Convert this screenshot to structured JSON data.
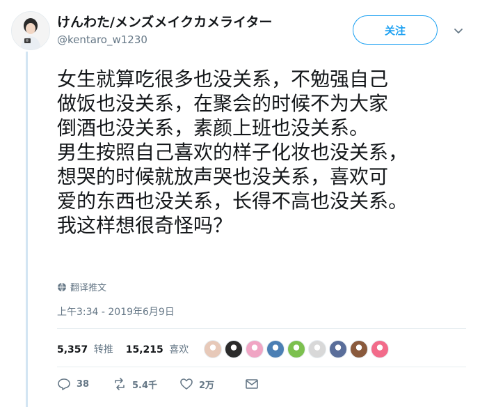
{
  "author": {
    "display_name": "けんわた/メンズメイクカメライター",
    "handle": "@kentaro_w1230"
  },
  "follow_button": {
    "label": "关注"
  },
  "tweet": {
    "lines": [
      "女生就算吃很多也没关系，不勉强自己",
      "做饭也没关系，在聚会的时候不为大家",
      "倒酒也没关系，素颜上班也没关系。",
      "男生按照自己喜欢的样子化妆也没关系，",
      "想哭的时候就放声哭也没关系，喜欢可",
      "爱的东西也没关系，长得不高也没关系。",
      "我这样想很奇怪吗？"
    ],
    "translate_label": "翻译推文",
    "timestamp": "上午3:34 - 2019年6月9日"
  },
  "stats": {
    "retweets_count": "5,357",
    "retweets_label": "转推",
    "likes_count": "15,215",
    "likes_label": "喜欢"
  },
  "liker_avatar_colors": [
    "#e7c9b9",
    "#2b2b2b",
    "#f0a5c4",
    "#4b7fb4",
    "#7cc04f",
    "#d8d8d8",
    "#5a6e9a",
    "#8a5a3c",
    "#f26b8a"
  ],
  "actions": {
    "reply_count": "38",
    "retweet_count": "5.4千",
    "like_count": "2万"
  },
  "colors": {
    "accent": "#1da1f2",
    "muted": "#657786",
    "thread_line": "#d3e5f3"
  }
}
